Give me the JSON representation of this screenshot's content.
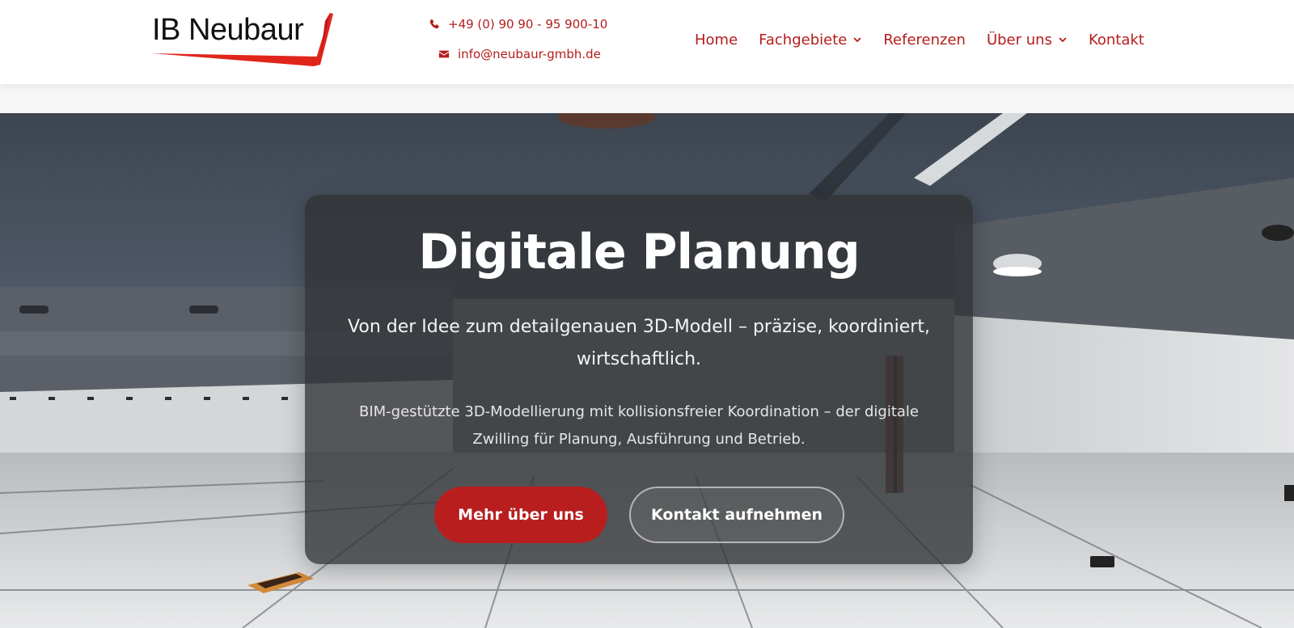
{
  "brand": {
    "name": "IB Neubaur",
    "accent": "#b51c1c",
    "logo_red": "#e0251b"
  },
  "contact": {
    "phone_icon": "phone-icon",
    "phone": "+49 (0) 90 90 - 95 900-10",
    "email_icon": "envelope-icon",
    "email": "info@neubaur-gmbh.de"
  },
  "nav": {
    "items": [
      {
        "label": "Home"
      },
      {
        "label": "Fachgebiete",
        "icon": "chevron-down-icon"
      },
      {
        "label": "Referenzen"
      },
      {
        "label": "Über uns",
        "icon": "chevron-down-icon"
      },
      {
        "label": "Kontakt"
      }
    ]
  },
  "hero": {
    "title": "Digitale Planung",
    "lead": "Von der Idee zum detailgenauen 3D-Modell – präzise, koordiniert, wirtschaftlich.",
    "sub": "BIM-gestützte 3D-Modellierung mit kollisionsfreier Koordination – der digitale Zwilling für Planung, Ausführung und Betrieb.",
    "primary_button": "Mehr über uns",
    "secondary_button": "Kontakt aufnehmen",
    "button_color": "#b81e1e"
  }
}
